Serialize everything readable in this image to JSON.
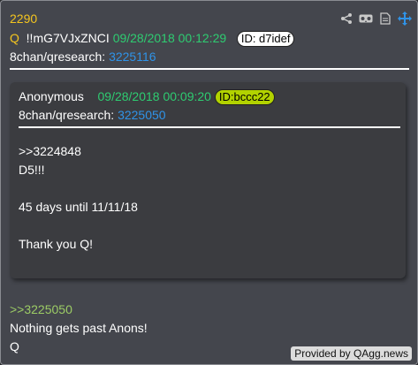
{
  "post": {
    "number": "2290",
    "q_label": "Q",
    "tripcode": "!!mG7VJxZNCI",
    "timestamp": "09/28/2018 00:12:29",
    "id": "ID: d7idef",
    "board": "8chan/qresearch:",
    "post_ref": "3225116",
    "body_lines": [
      ">>3225050",
      "Nothing gets past Anons!",
      "Q"
    ]
  },
  "quoted": {
    "author": "Anonymous",
    "timestamp": "09/28/2018 00:09:20",
    "id": "ID:bccc22",
    "board": "8chan/qresearch:",
    "post_ref": "3225050",
    "body_lines": [
      ">>3224848",
      "D5!!!",
      "",
      "45 days until 11/11/18",
      "",
      "Thank you Q!"
    ]
  },
  "toolbar": {
    "icons": [
      "share-icon",
      "vr-glasses-icon",
      "document-icon",
      "move-icon"
    ]
  },
  "credit": "Provided by QAgg.news",
  "colors": {
    "background": "#44464d",
    "accent_yellow": "#f4c51f",
    "date_green": "#2ecc71",
    "link_blue": "#2f93e8",
    "greentext": "#9ccc65",
    "id_quote_bg": "#b2d200"
  }
}
